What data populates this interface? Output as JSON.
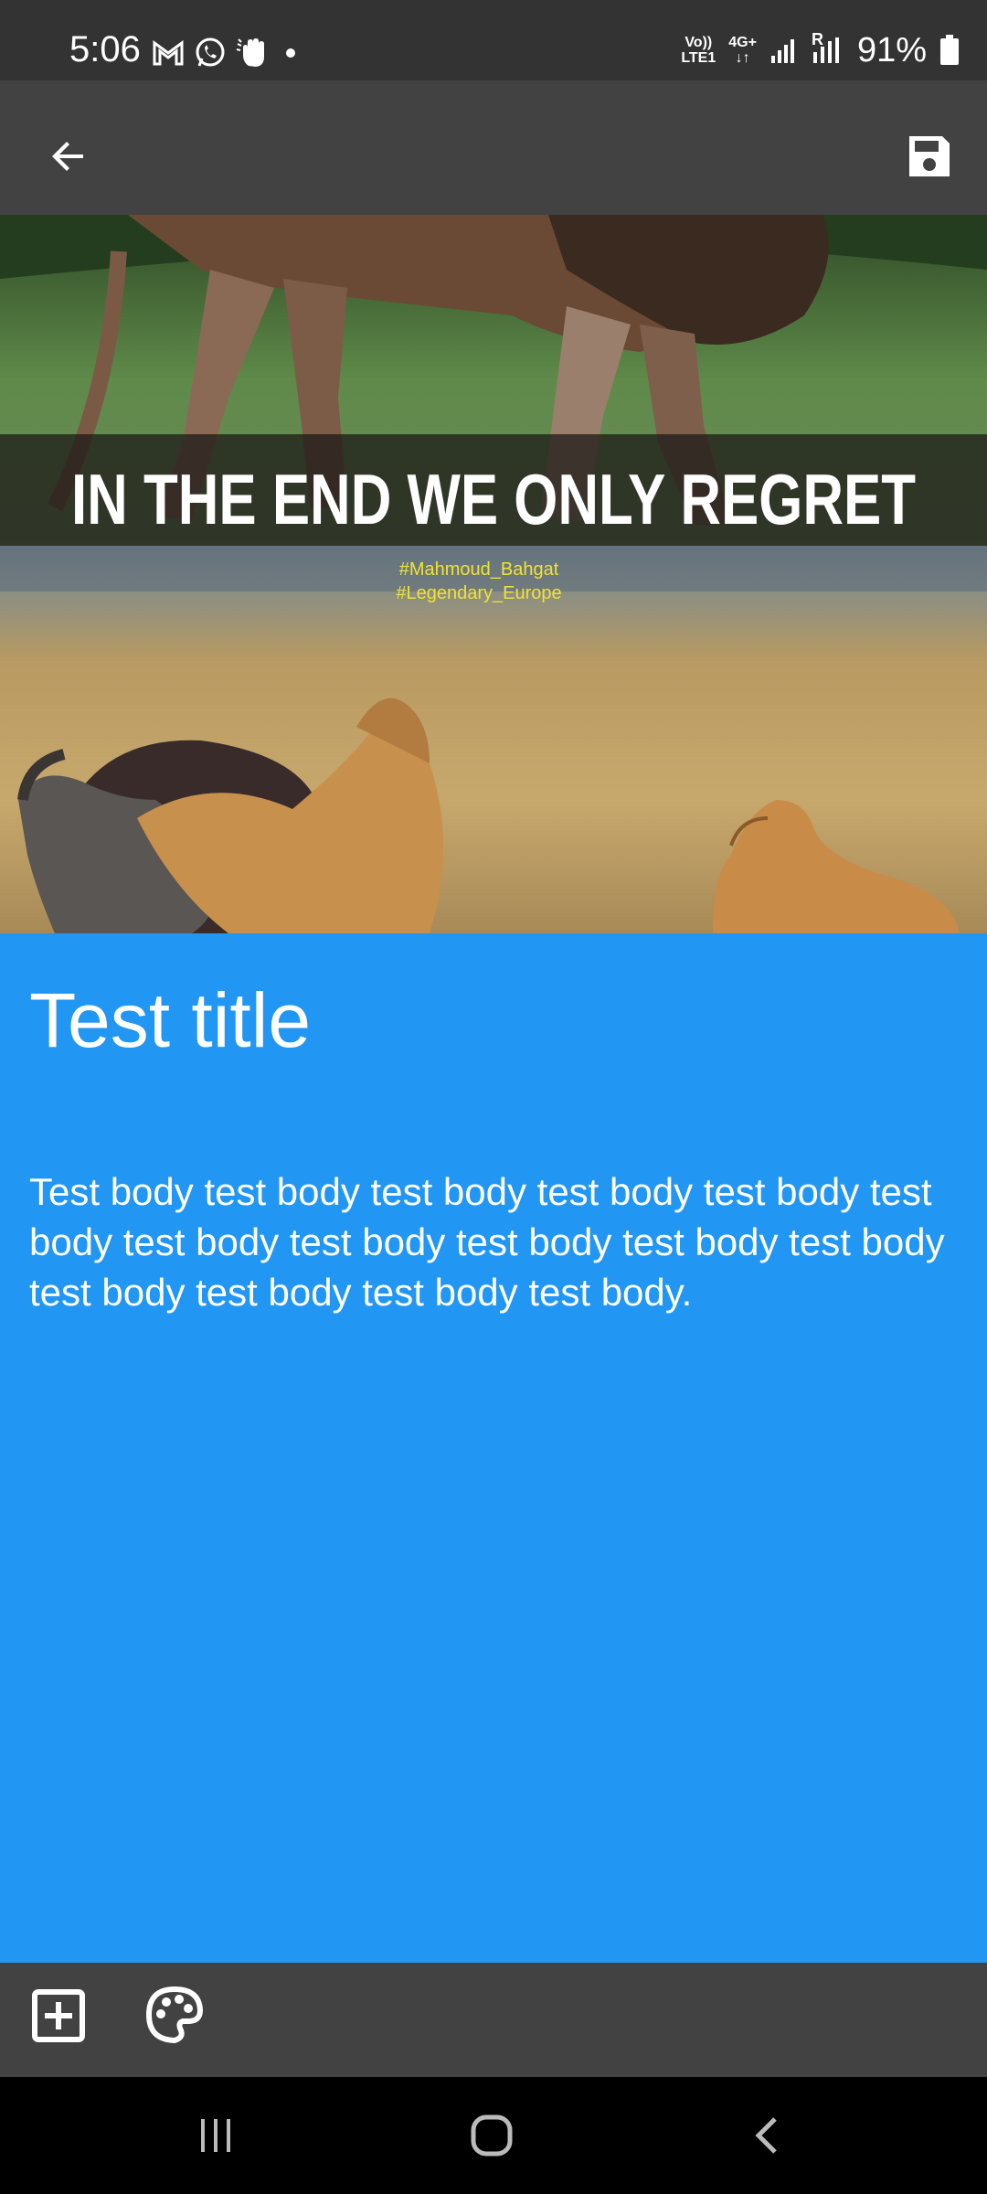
{
  "status_bar": {
    "time": "5:06",
    "network_label_top": "Vo))",
    "network_label_bottom": "LTE1",
    "network_type": "4G+",
    "roaming": "R",
    "battery_percent": "91%"
  },
  "note": {
    "image_caption": "IN THE END WE ONLY REGRET",
    "hashtag_1": "#Mahmoud_Bahgat",
    "hashtag_2": "#Legendary_Europe",
    "title": "Test title",
    "body": "Test body test body test body test body test body test body test body test body test body test body test body test body test body test body test body."
  },
  "colors": {
    "note_background": "#2196F3",
    "appbar": "#424242",
    "statusbar": "#333333",
    "navbar": "#000000"
  },
  "icons": {
    "back": "arrow-left-icon",
    "save": "save-icon",
    "add": "add-box-icon",
    "palette": "palette-icon"
  }
}
